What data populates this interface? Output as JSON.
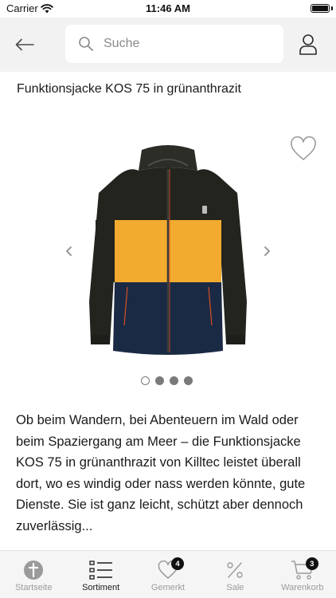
{
  "status_bar": {
    "carrier": "Carrier",
    "time": "11:46 AM"
  },
  "header": {
    "back_icon": "arrow-left-icon",
    "search_placeholder": "Suche",
    "user_icon": "user-icon"
  },
  "product": {
    "title": "Funktionsjacke KOS 75 in grünanthrazit",
    "favorite_icon": "heart-outline-icon",
    "image_colors": {
      "top": "#24241f",
      "middle": "#f2ab2f",
      "bottom": "#1b2a44",
      "zip_trim": "#d8501f"
    },
    "gallery_total": 4,
    "gallery_active_index": 0,
    "description": "Ob beim Wandern, bei Abenteuern im Wald oder beim Spaziergang am Meer – die Funktionsjacke KOS 75 in grünanthrazit von Killtec leistet überall dort, wo es windig oder nass werden könnte, gute Dienste. Sie ist ganz leicht, schützt aber dennoch zuverlässig..."
  },
  "tabs": [
    {
      "label": "Startseite",
      "icon": "home-plus-icon",
      "active": false
    },
    {
      "label": "Sortiment",
      "icon": "list-icon",
      "active": true
    },
    {
      "label": "Gemerkt",
      "icon": "heart-icon",
      "active": false,
      "badge": "4"
    },
    {
      "label": "Sale",
      "icon": "percent-icon",
      "active": false
    },
    {
      "label": "Warenkorb",
      "icon": "cart-icon",
      "active": false,
      "badge": "3"
    }
  ]
}
